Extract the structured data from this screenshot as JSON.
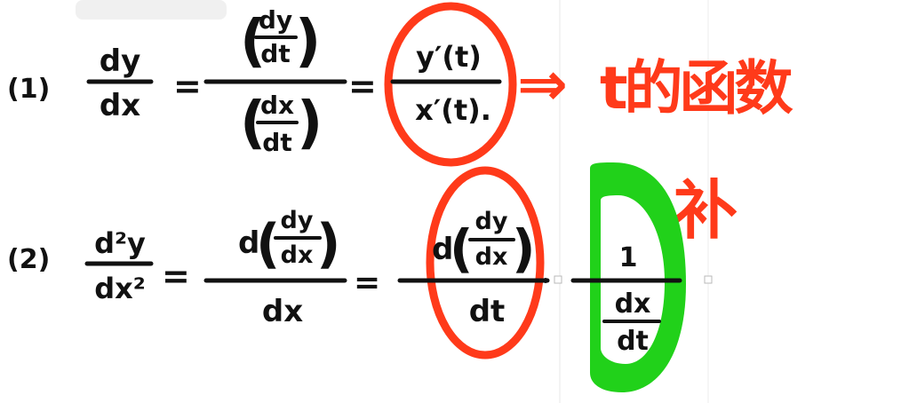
{
  "colors": {
    "ink": "#111111",
    "orange_annotation": "#ff3a1a",
    "green_highlight": "#21d11a",
    "selection_handle": "#b9b9b9",
    "guide_line": "#e7e7e7"
  },
  "equation1": {
    "label": "(1)",
    "lhs_num": "dy",
    "lhs_den": "dx",
    "mid_num_num": "dy",
    "mid_num_den": "dt",
    "mid_den_num": "dx",
    "mid_den_den": "dt",
    "rhs_num": "y′(t)",
    "rhs_den": "x′(t)."
  },
  "equation2": {
    "label": "(2)",
    "lhs_num": "d²y",
    "lhs_den": "dx²",
    "mid_num_d": "d",
    "mid_num_inner_num": "dy",
    "mid_num_inner_den": "dx",
    "mid_den": "dx",
    "rhs1_num_d": "d",
    "rhs1_num_inner_num": "dy",
    "rhs1_num_inner_den": "dx",
    "rhs1_den": "dt",
    "rhs2_num": "1",
    "rhs2_den_num": "dx",
    "rhs2_den_den": "dt"
  },
  "annotation": {
    "arrow": "⇒",
    "text_line1": "t的函数",
    "text_line2": "补"
  }
}
